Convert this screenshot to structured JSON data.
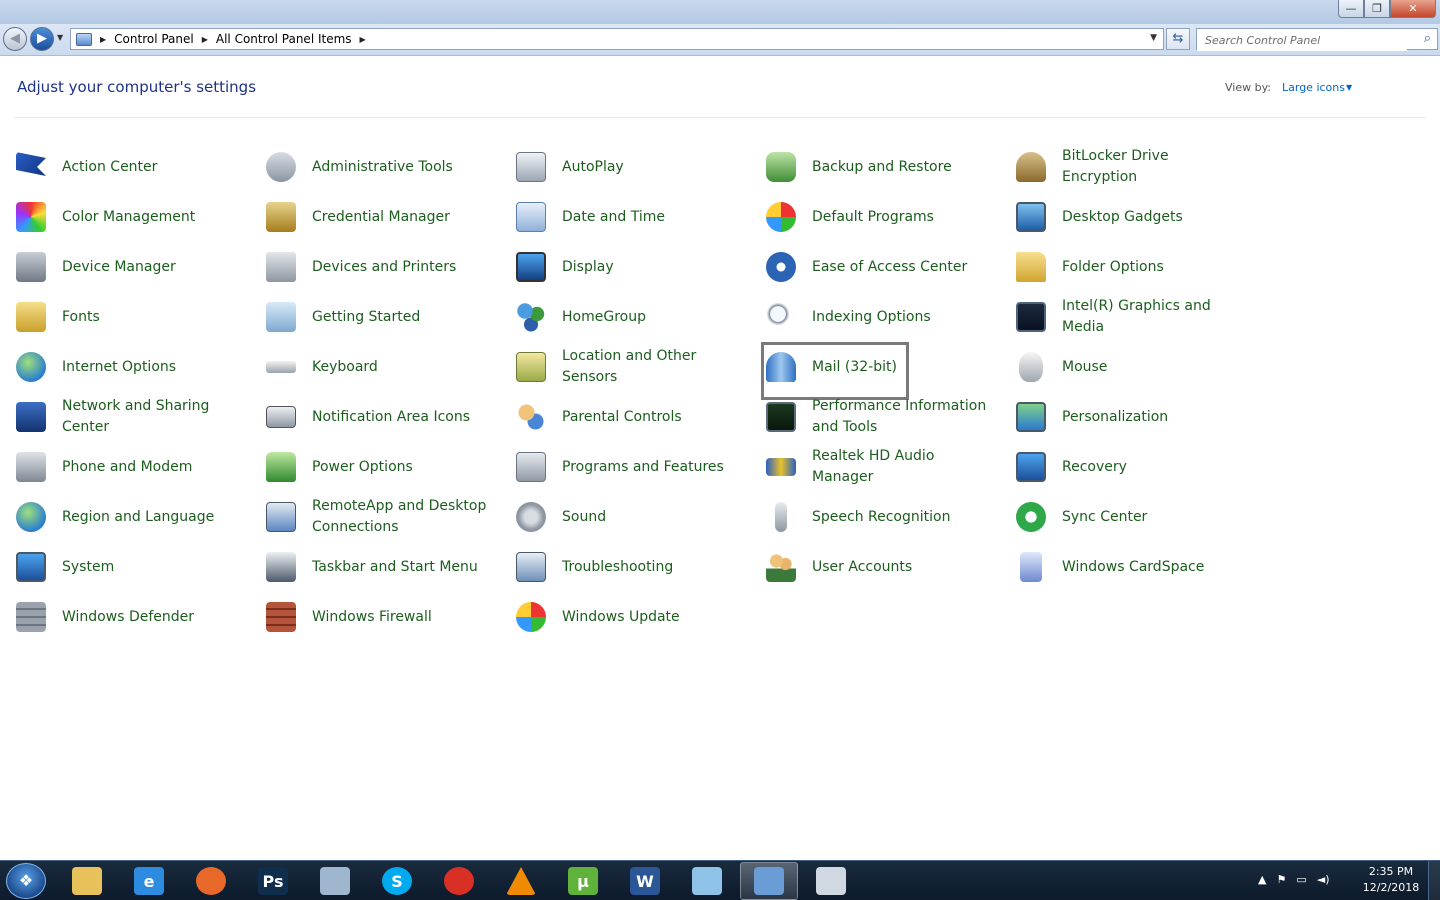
{
  "window": {
    "controls": {
      "minimize": "—",
      "maximize": "❐",
      "close": "✕"
    }
  },
  "nav": {
    "back": "◀",
    "forward": "▶"
  },
  "breadcrumb": [
    "Control Panel",
    "All Control Panel Items"
  ],
  "search": {
    "placeholder": "Search Control Panel"
  },
  "header": {
    "title": "Adjust your computer's settings",
    "view_by_label": "View by:",
    "view_by_value": "Large icons"
  },
  "items": [
    {
      "label": "Action Center",
      "icon": "flag-icon"
    },
    {
      "label": "Administrative Tools",
      "icon": "admin-tools-icon"
    },
    {
      "label": "AutoPlay",
      "icon": "autoplay-icon"
    },
    {
      "label": "Backup and Restore",
      "icon": "backup-icon"
    },
    {
      "label": "BitLocker Drive Encryption",
      "icon": "bitlocker-key-icon"
    },
    {
      "label": "Color Management",
      "icon": "color-management-icon"
    },
    {
      "label": "Credential Manager",
      "icon": "vault-icon"
    },
    {
      "label": "Date and Time",
      "icon": "calendar-clock-icon"
    },
    {
      "label": "Default Programs",
      "icon": "default-programs-icon"
    },
    {
      "label": "Desktop Gadgets",
      "icon": "gadgets-icon"
    },
    {
      "label": "Device Manager",
      "icon": "device-manager-icon"
    },
    {
      "label": "Devices and Printers",
      "icon": "printer-icon"
    },
    {
      "label": "Display",
      "icon": "monitor-icon"
    },
    {
      "label": "Ease of Access Center",
      "icon": "ease-of-access-icon"
    },
    {
      "label": "Folder Options",
      "icon": "folder-icon"
    },
    {
      "label": "Fonts",
      "icon": "fonts-icon"
    },
    {
      "label": "Getting Started",
      "icon": "getting-started-icon"
    },
    {
      "label": "HomeGroup",
      "icon": "homegroup-icon"
    },
    {
      "label": "Indexing Options",
      "icon": "indexing-icon"
    },
    {
      "label": "Intel(R) Graphics and Media",
      "icon": "intel-graphics-icon"
    },
    {
      "label": "Internet Options",
      "icon": "globe-icon"
    },
    {
      "label": "Keyboard",
      "icon": "keyboard-icon"
    },
    {
      "label": "Location and Other Sensors",
      "icon": "location-sensor-icon"
    },
    {
      "label": "Mail (32-bit)",
      "icon": "mail-icon"
    },
    {
      "label": "Mouse",
      "icon": "mouse-icon"
    },
    {
      "label": "Network and Sharing Center",
      "icon": "network-icon"
    },
    {
      "label": "Notification Area Icons",
      "icon": "notification-area-icon"
    },
    {
      "label": "Parental Controls",
      "icon": "parental-controls-icon"
    },
    {
      "label": "Performance Information and Tools",
      "icon": "performance-icon"
    },
    {
      "label": "Personalization",
      "icon": "personalization-icon"
    },
    {
      "label": "Phone and Modem",
      "icon": "phone-icon"
    },
    {
      "label": "Power Options",
      "icon": "battery-icon"
    },
    {
      "label": "Programs and Features",
      "icon": "programs-icon"
    },
    {
      "label": "Realtek HD Audio Manager",
      "icon": "audio-wave-icon"
    },
    {
      "label": "Recovery",
      "icon": "recovery-icon"
    },
    {
      "label": "Region and Language",
      "icon": "region-globe-icon"
    },
    {
      "label": "RemoteApp and Desktop Connections",
      "icon": "remote-desktop-icon"
    },
    {
      "label": "Sound",
      "icon": "speaker-icon"
    },
    {
      "label": "Speech Recognition",
      "icon": "microphone-icon"
    },
    {
      "label": "Sync Center",
      "icon": "sync-icon"
    },
    {
      "label": "System",
      "icon": "system-icon"
    },
    {
      "label": "Taskbar and Start Menu",
      "icon": "taskbar-icon"
    },
    {
      "label": "Troubleshooting",
      "icon": "troubleshooting-icon"
    },
    {
      "label": "User Accounts",
      "icon": "users-icon"
    },
    {
      "label": "Windows CardSpace",
      "icon": "cardspace-icon"
    },
    {
      "label": "Windows Defender",
      "icon": "defender-wall-icon"
    },
    {
      "label": "Windows Firewall",
      "icon": "firewall-icon"
    },
    {
      "label": "Windows Update",
      "icon": "windows-update-icon"
    }
  ],
  "selected_item": "Mail (32-bit)",
  "taskbar": {
    "apps": [
      {
        "name": "file-explorer-icon",
        "glyph": "",
        "color": "#e7c25a"
      },
      {
        "name": "internet-explorer-icon",
        "glyph": "e",
        "color": "#2d8be0"
      },
      {
        "name": "firefox-icon",
        "glyph": "",
        "color": "#e8682a"
      },
      {
        "name": "photoshop-icon",
        "glyph": "Ps",
        "color": "#0f2d4d"
      },
      {
        "name": "on-screen-keyboard-icon",
        "glyph": "",
        "color": "#9fb6cf"
      },
      {
        "name": "skype-icon",
        "glyph": "S",
        "color": "#00a9f0"
      },
      {
        "name": "chrome-icon",
        "glyph": "",
        "color": "#d93025"
      },
      {
        "name": "vlc-icon",
        "glyph": "",
        "color": "#f08a00"
      },
      {
        "name": "utorrent-icon",
        "glyph": "µ",
        "color": "#5fb23a"
      },
      {
        "name": "word-icon",
        "glyph": "W",
        "color": "#2b5797"
      },
      {
        "name": "notepad-icon",
        "glyph": "",
        "color": "#8fc3e8"
      },
      {
        "name": "control-panel-icon",
        "glyph": "",
        "color": "#6a9cd6"
      },
      {
        "name": "paint-icon",
        "glyph": "",
        "color": "#d0d8e2"
      }
    ],
    "tray": [
      "▲",
      "⚑",
      "▭",
      "◄)"
    ],
    "time": "2:35 PM",
    "date": "12/2/2018"
  },
  "colors": {
    "link": "#1c5d1e",
    "heading": "#1e3287",
    "accent": "#0066cc"
  }
}
